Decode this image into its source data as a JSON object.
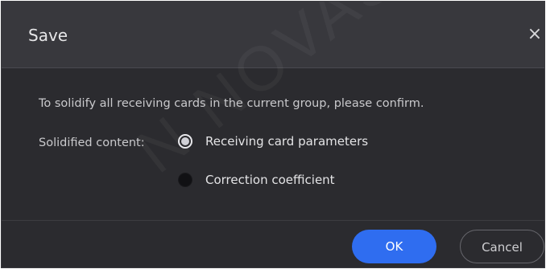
{
  "dialog": {
    "title": "Save",
    "close_icon": "close-icon",
    "close_glyph": "×",
    "message": "To solidify all receiving cards in the current group, please confirm.",
    "content_label": "Solidified content:",
    "options": [
      {
        "label": "Receiving card parameters",
        "checked": true
      },
      {
        "label": "Correction coefficient",
        "checked": false
      }
    ],
    "ok_label": "OK",
    "cancel_label": "Cancel"
  },
  "watermark": "N NOVASTAR",
  "colors": {
    "dialog_bg": "#2b2b2f",
    "header_bg": "#38383d",
    "primary": "#2f6df0",
    "text": "#e4e4e6"
  }
}
